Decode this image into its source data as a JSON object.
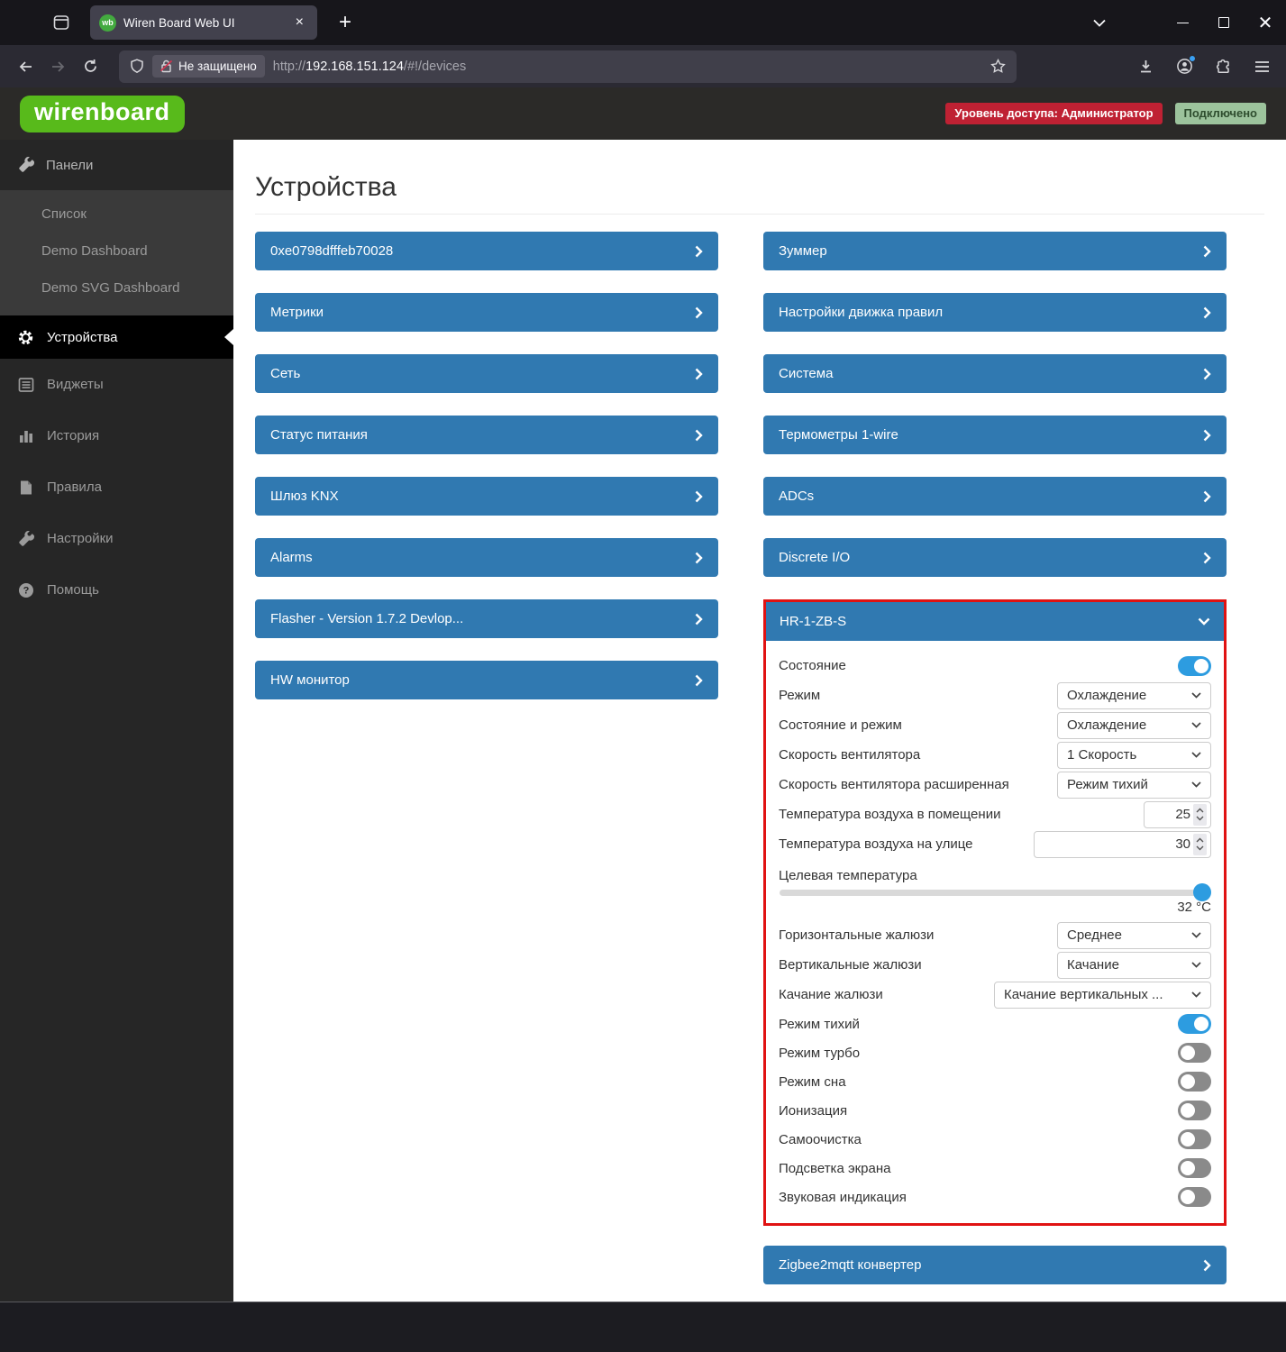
{
  "browser": {
    "tab_title": "Wiren Board Web UI",
    "favicon_text": "wb",
    "security_label": "Не защищено",
    "url_scheme": "http://",
    "url_host": "192.168.151.124",
    "url_path": "/#!/devices"
  },
  "header": {
    "logo_text": "wirenboard",
    "access_badge": "Уровень доступа: Администратор",
    "connection_badge": "Подключено"
  },
  "sidebar": {
    "group_label": "Панели",
    "sub_items": [
      "Список",
      "Demo Dashboard",
      "Demo SVG Dashboard"
    ],
    "items": [
      "Устройства",
      "Виджеты",
      "История",
      "Правила",
      "Настройки",
      "Помощь"
    ]
  },
  "main": {
    "title": "Устройства",
    "left_devices": [
      "0xe0798dfffeb70028",
      "Метрики",
      "Сеть",
      "Статус питания",
      "Шлюз KNX",
      "Alarms",
      "Flasher - Version 1.7.2 Devlop...",
      "HW монитор"
    ],
    "right_devices": [
      "Зуммер",
      "Настройки движка правил",
      "Система",
      "Термометры 1-wire",
      "ADCs",
      "Discrete I/O"
    ],
    "bottom_device": "Zigbee2mqtt конвертер"
  },
  "panel": {
    "title": "HR-1-ZB-S",
    "state": {
      "label": "Состояние",
      "value": "on"
    },
    "mode": {
      "label": "Режим",
      "value": "Охлаждение"
    },
    "state_mode": {
      "label": "Состояние и режим",
      "value": "Охлаждение"
    },
    "fan_speed": {
      "label": "Скорость вентилятора",
      "value": "1 Скорость"
    },
    "fan_speed_ext": {
      "label": "Скорость вентилятора расширенная",
      "value": "Режим тихий"
    },
    "indoor_temp": {
      "label": "Температура воздуха в помещении",
      "value": "25"
    },
    "outdoor_temp": {
      "label": "Температура воздуха на улице",
      "value": "30"
    },
    "target_temp": {
      "label": "Целевая температура",
      "value": "32 °C"
    },
    "horizontal_blinds": {
      "label": "Горизонтальные жалюзи",
      "value": "Среднее"
    },
    "vertical_blinds": {
      "label": "Вертикальные жалюзи",
      "value": "Качание"
    },
    "blinds_swing": {
      "label": "Качание жалюзи",
      "value": "Качание вертикальных ..."
    },
    "quiet_mode": {
      "label": "Режим тихий",
      "value": "on"
    },
    "turbo_mode": {
      "label": "Режим турбо",
      "value": "off"
    },
    "sleep_mode": {
      "label": "Режим сна",
      "value": "off"
    },
    "ionization": {
      "label": "Ионизация",
      "value": "off"
    },
    "self_clean": {
      "label": "Самоочистка",
      "value": "off"
    },
    "backlight": {
      "label": "Подсветка экрана",
      "value": "off"
    },
    "sound_indication": {
      "label": "Звуковая индикация",
      "value": "off"
    }
  },
  "colors": {
    "accent_blue": "#3079b1",
    "toggle_on_blue": "#2d9ce0",
    "annotation_red": "#e01212",
    "logo_green": "#58ba1b",
    "badge_red": "#bf2133",
    "badge_green": "#9cc39c"
  }
}
